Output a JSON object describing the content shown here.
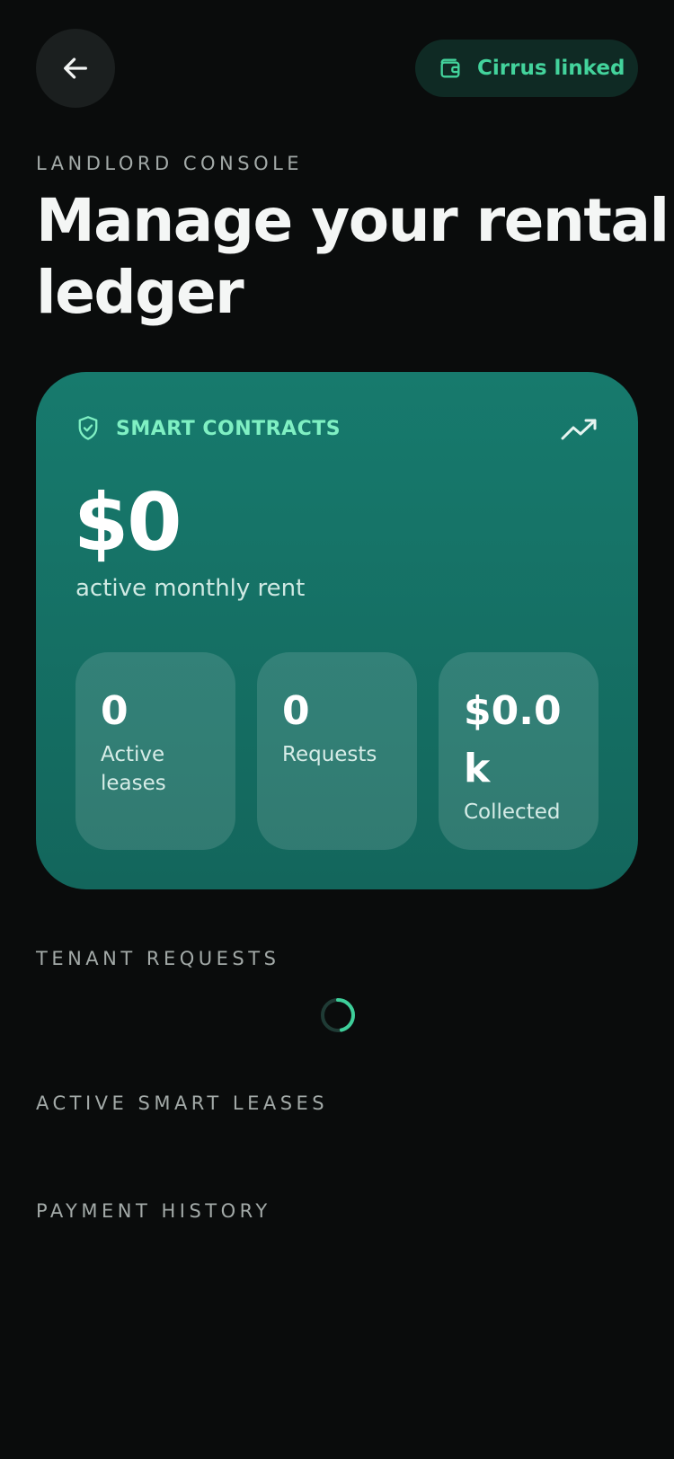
{
  "header": {
    "back_icon": "arrow-left-icon",
    "wallet": {
      "icon": "wallet-icon",
      "label": "Cirrus linked",
      "accent_color": "#43d39c"
    }
  },
  "hero": {
    "eyebrow": "LANDLORD CONSOLE",
    "title": "Manage your rental ledger"
  },
  "summary_card": {
    "tag_icon": "shield-check-icon",
    "tag": "SMART CONTRACTS",
    "trend_icon": "trending-up-icon",
    "amount": "$0",
    "caption": "active monthly rent",
    "stats": [
      {
        "value": "0",
        "label": "Active leases"
      },
      {
        "value": "0",
        "label": "Requests"
      },
      {
        "value": "$0.0k",
        "label": "Collected"
      }
    ]
  },
  "sections": {
    "tenant_requests": "TENANT REQUESTS",
    "active_leases": "ACTIVE SMART LEASES",
    "payment_history": "PAYMENT HISTORY"
  },
  "colors": {
    "background": "#0a0c0c",
    "card_gradient_top": "#177a6d",
    "card_gradient_bottom": "#13665c",
    "tag_color": "#7ff0c3"
  }
}
